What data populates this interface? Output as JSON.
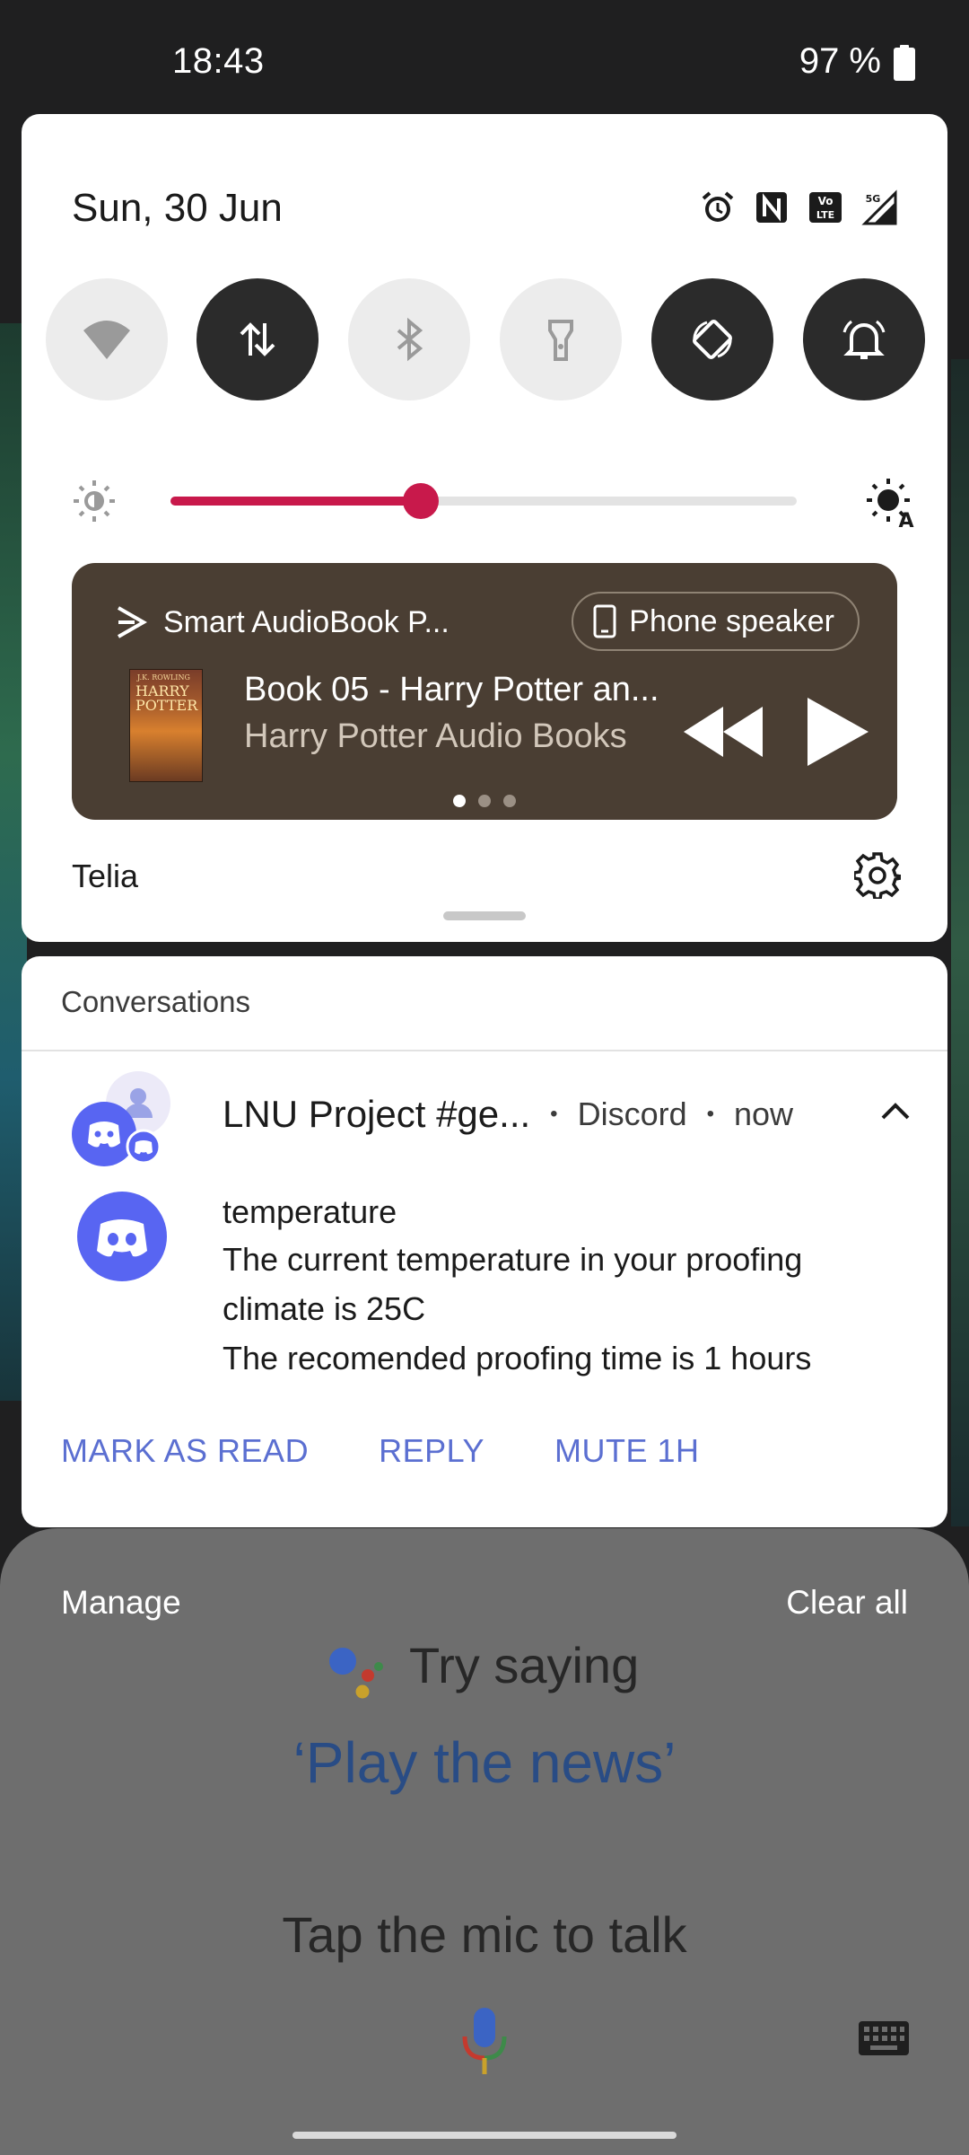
{
  "status_bar": {
    "time": "18:43",
    "battery": "97 %"
  },
  "quick_settings": {
    "date": "Sun, 30 Jun",
    "status_icons": [
      "alarm-icon",
      "nfc-icon",
      "volte-icon",
      "signal-5g-icon"
    ],
    "tiles": [
      {
        "name": "wifi",
        "icon": "wifi-icon",
        "state": "off"
      },
      {
        "name": "mobile-data",
        "icon": "data-arrows-icon",
        "state": "on"
      },
      {
        "name": "bluetooth",
        "icon": "bluetooth-icon",
        "state": "off"
      },
      {
        "name": "flashlight",
        "icon": "flashlight-icon",
        "state": "off"
      },
      {
        "name": "auto-rotate",
        "icon": "rotate-icon",
        "state": "on"
      },
      {
        "name": "sound",
        "icon": "bell-icon",
        "state": "on"
      }
    ],
    "brightness_level": 0.4,
    "accent_color": "#c8194b",
    "carrier": "Telia"
  },
  "media": {
    "app_name": "Smart AudioBook P...",
    "output_label": "Phone speaker",
    "title": "Book 05 - Harry Potter an...",
    "artist": "Harry Potter Audio Books",
    "album_art_text_1": "J.K. ROWLING",
    "album_art_text_2": "HARRY POTTER",
    "card_color": "#4a3e33",
    "page_index": 0,
    "page_count": 3
  },
  "notifications": {
    "section_header": "Conversations",
    "title": "LNU Project #ge...",
    "app": "Discord",
    "time": "now",
    "sender": "temperature",
    "body": "The current temperature in your proofing climate is 25C\nThe recomended proofing time is 1 hours",
    "actions": {
      "mark_read": "MARK AS READ",
      "reply": "REPLY",
      "mute": "MUTE 1H"
    },
    "action_color": "#5b6fd1"
  },
  "footer": {
    "manage": "Manage",
    "clear_all": "Clear all"
  },
  "assistant": {
    "try_saying": "Try saying",
    "suggestion": "‘Play the news’",
    "tap_mic": "Tap the mic to talk"
  }
}
